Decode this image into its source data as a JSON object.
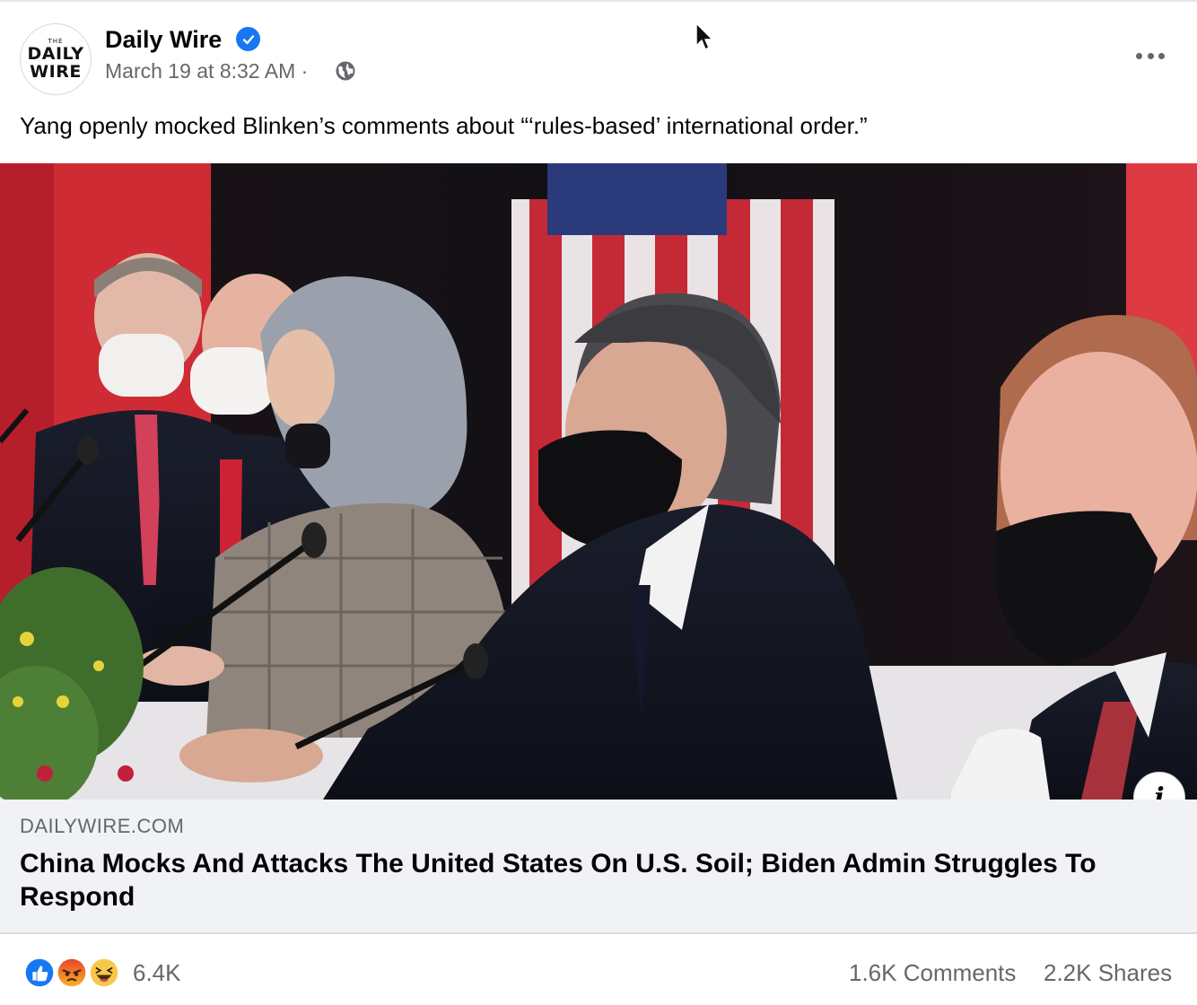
{
  "post": {
    "page_name": "Daily Wire",
    "avatar_text": {
      "top": "THE",
      "line1": "DAILY",
      "line2": "WIRE"
    },
    "timestamp": "March 19 at 8:32 AM",
    "separator": "·",
    "privacy_icon": "globe-icon",
    "verified_icon": "verified-badge-icon",
    "more_icon": "more-options-icon",
    "text": "Yang openly mocked Blinken’s comments about “‘rules-based’ international order.”"
  },
  "link_preview": {
    "domain": "DAILYWIRE.COM",
    "title": "China Mocks And Attacks The United States On U.S. Soil; Biden Admin Struggles To Respond",
    "info_button": "i"
  },
  "engagement": {
    "reaction_icons": [
      "like-icon",
      "angry-icon",
      "haha-icon"
    ],
    "reaction_count": "6.4K",
    "comments": "1.6K Comments",
    "shares": "2.2K Shares"
  },
  "colors": {
    "brand_blue": "#1877f2",
    "secondary_text": "#65676b",
    "link_bg": "#f0f2f5"
  }
}
